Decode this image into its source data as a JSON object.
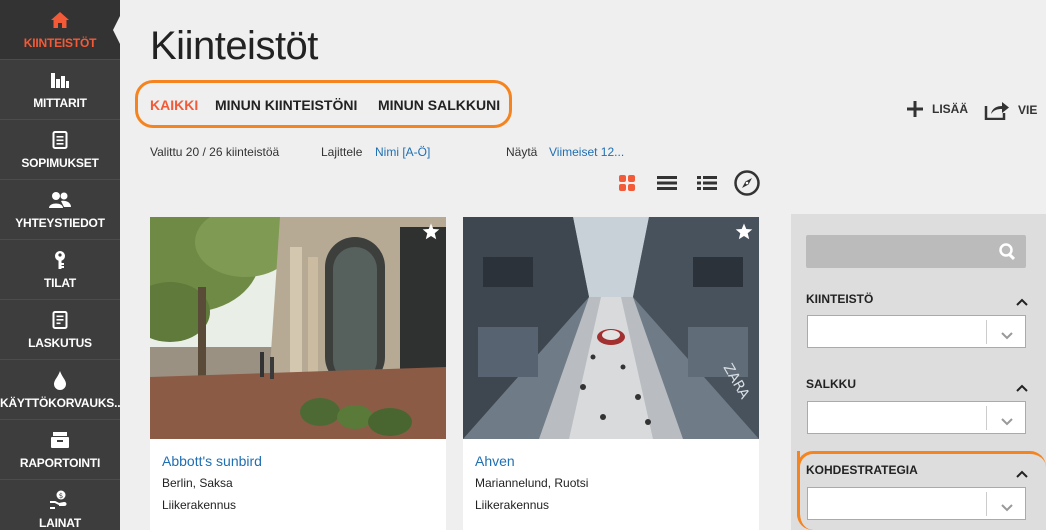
{
  "sidebar": {
    "items": [
      {
        "label": "KIINTEISTÖT",
        "icon": "home-icon"
      },
      {
        "label": "MITTARIT",
        "icon": "bar-chart-icon"
      },
      {
        "label": "SOPIMUKSET",
        "icon": "document-icon"
      },
      {
        "label": "YHTEYSTIEDOT",
        "icon": "contacts-icon"
      },
      {
        "label": "TILAT",
        "icon": "key-icon"
      },
      {
        "label": "LASKUTUS",
        "icon": "invoice-icon"
      },
      {
        "label": "KÄYTTÖKORVAUKS...",
        "icon": "drop-icon"
      },
      {
        "label": "RAPORTOINTI",
        "icon": "report-icon"
      },
      {
        "label": "LAINAT",
        "icon": "loan-icon"
      }
    ]
  },
  "page": {
    "title": "Kiinteistöt",
    "tabs": [
      "KAIKKI",
      "MINUN KIINTEISTÖNI",
      "MINUN SALKKUNI"
    ],
    "actions": {
      "add": "LISÄÄ",
      "export": "VIE"
    },
    "selected_text": "Valittu 20 / 26 kiinteistöä",
    "sort_label": "Lajittele",
    "sort_value": "Nimi [A-Ö]",
    "show_label": "Näytä",
    "show_value": "Viimeiset 12..."
  },
  "cards": [
    {
      "name": "Abbott's sunbird",
      "location": "Berlin, Saksa",
      "type": "Liikerakennus"
    },
    {
      "name": "Ahven",
      "location": "Mariannelund, Ruotsi",
      "type": "Liikerakennus"
    }
  ],
  "filters": {
    "search_placeholder": "",
    "groups": [
      {
        "label": "KIINTEISTÖ",
        "value": ""
      },
      {
        "label": "SALKKU",
        "value": ""
      },
      {
        "label": "KOHDESTRATEGIA",
        "value": ""
      }
    ]
  },
  "colors": {
    "accent": "#f25a38",
    "highlight": "#f5841f",
    "link": "#1f6fb3",
    "sidebar": "#3d3d3d"
  }
}
